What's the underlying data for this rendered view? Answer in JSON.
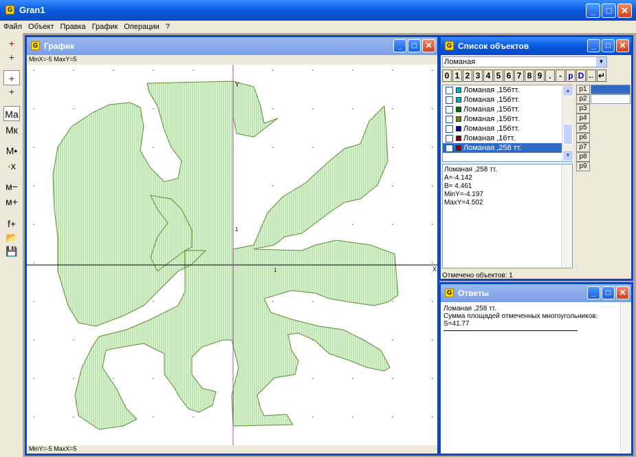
{
  "app": {
    "title": "Gran1",
    "icon": "G"
  },
  "menu": [
    "Файл",
    "Объект",
    "Правка",
    "График",
    "Операции",
    "?"
  ],
  "toolbar": [
    {
      "label": "+",
      "name": "add-point-red-tool",
      "color": "#c00000"
    },
    {
      "label": "+",
      "name": "add-point-tool",
      "color": "#333"
    },
    {
      "label": "+",
      "name": "add-segment-tool",
      "color": "#333"
    },
    {
      "label": "+",
      "name": "add-polyline-tool",
      "color": "#333"
    },
    {
      "label": "Ма",
      "name": "scale-ma-tool",
      "color": "#000"
    },
    {
      "label": "Мк",
      "name": "scale-mk-tool",
      "color": "#000"
    },
    {
      "label": "М•",
      "name": "scale-point-tool",
      "color": "#000"
    },
    {
      "label": "·x",
      "name": "scale-xy-tool",
      "color": "#000"
    },
    {
      "label": "м−",
      "name": "zoom-out-tool",
      "color": "#000"
    },
    {
      "label": "м+",
      "name": "zoom-in-tool",
      "color": "#000"
    },
    {
      "label": "f+",
      "name": "function-tool",
      "color": "#000"
    },
    {
      "label": "📂",
      "name": "open-folder-icon",
      "color": "#b08000"
    },
    {
      "label": "💾",
      "name": "save-disk-icon",
      "color": "#000"
    }
  ],
  "graph_window": {
    "title": "График",
    "top_status": "MinX=-5  MaxY=5",
    "bottom_status": "MinY=-5  MaxX=5",
    "axis_x": "X",
    "axis_y": "Y",
    "tick_x": "1",
    "tick_y": "1"
  },
  "list_window": {
    "title": "Список объектов",
    "combo_value": "Ломаная",
    "keypad": [
      "0",
      "1",
      "2",
      "3",
      "4",
      "5",
      "6",
      "7",
      "8",
      "9",
      ".",
      "-",
      "p",
      "D",
      "←",
      "↵"
    ],
    "objects": [
      {
        "label": "Ломаная ,156тт.",
        "color": "#00b0c0",
        "checked": ""
      },
      {
        "label": "Ломаная ,156тт.",
        "color": "#00b0c0",
        "checked": ""
      },
      {
        "label": "Ломаная ,156тт.",
        "color": "#007000",
        "checked": ""
      },
      {
        "label": "Ломаная ,156тт.",
        "color": "#808000",
        "checked": ""
      },
      {
        "label": "Ломаная ,156тт.",
        "color": "#000080",
        "checked": ""
      },
      {
        "label": "Ломаная ,16тт.",
        "color": "#800000",
        "checked": ""
      },
      {
        "label": "Ломаная ,258 тт.",
        "color": "#800000",
        "checked": "✔"
      }
    ],
    "params": [
      "p1",
      "p2",
      "p3",
      "p4",
      "p5",
      "p6",
      "p7",
      "p8",
      "p9"
    ],
    "info": [
      "Ломаная ,258 тт.",
      "A=-4.142",
      "B= 4.461",
      "MinY=-4.197",
      "MaxY=4.502"
    ],
    "status": "Отмечено объектов: 1"
  },
  "answers_window": {
    "title": "Ответы",
    "lines": [
      "Ломаная ,258 тт.",
      "Сумма площадей отмеченных многоугольников:",
      "S=41.77"
    ]
  },
  "colors": {
    "fill": "#bfe8b0",
    "stroke": "#5c8a30",
    "axis_y": "#b04cc0",
    "accent": "#0a48c8"
  }
}
